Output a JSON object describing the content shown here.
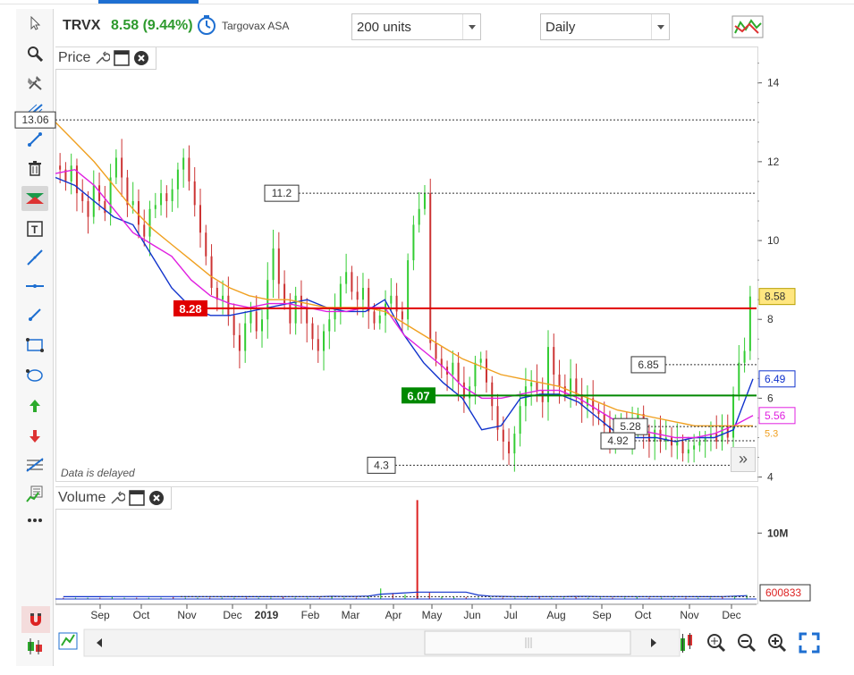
{
  "header": {
    "symbol": "TRVX",
    "change": "8.58 (9.44%)",
    "company": "Targovax ASA",
    "units_select": "200 units",
    "period_select": "Daily"
  },
  "panels": {
    "price_label": "Price",
    "volume_label": "Volume",
    "delayed_note": "Data is delayed"
  },
  "colors": {
    "up_candle": "#33cc33",
    "down_candle": "#cc3333",
    "ma_blue": "#1133cc",
    "ma_magenta": "#e020e0",
    "ma_orange": "#f0a020",
    "support_red": "#e00000",
    "support_green": "#008800"
  },
  "icons": {
    "left_toolbar": [
      "cursor-icon",
      "zoom-icon",
      "tools-icon",
      "crosshair-icon",
      "line-select-icon",
      "trash-icon",
      "rectangle-tool-icon",
      "text-tool-icon",
      "trendline-icon",
      "horizontal-line-icon",
      "ray-icon",
      "box-tool-icon",
      "ellipse-tool-icon",
      "arrow-up-icon",
      "arrow-down-icon",
      "fibonacci-icon",
      "indicator-icon",
      "more-icon"
    ],
    "bottom_toolbar": [
      "edit-chart-icon",
      "scroll-left-icon",
      "scroll-right-icon",
      "chart-type-icon",
      "zoom-auto-icon",
      "zoom-out-icon",
      "zoom-in-icon",
      "fullscreen-icon"
    ]
  },
  "chart_data": [
    {
      "type": "candlestick",
      "title": "Price",
      "y_ticks": [
        "14",
        "12",
        "10",
        "8",
        "6",
        "4"
      ],
      "ylim": [
        3.9,
        14.9
      ],
      "x_ticks": [
        "Sep",
        "Oct",
        "Nov",
        "Dec",
        "2019",
        "Feb",
        "Mar",
        "Apr",
        "May",
        "Jun",
        "Jul",
        "Aug",
        "Sep",
        "Oct",
        "Nov",
        "Dec"
      ],
      "last_price": "8.58",
      "ma_labels": [
        "6.49",
        "5.56",
        "5.3"
      ],
      "annotations": [
        {
          "label": "13.06",
          "value": 13.06
        },
        {
          "label": "11.2",
          "value": 11.2
        },
        {
          "label": "6.85",
          "value": 6.85
        },
        {
          "label": "5.28",
          "value": 5.28
        },
        {
          "label": "4.92",
          "value": 4.92
        },
        {
          "label": "4.3",
          "value": 4.3
        }
      ],
      "support_lines": [
        {
          "label": "8.28",
          "value": 8.28,
          "color": "#e00000"
        },
        {
          "label": "6.07",
          "value": 6.07,
          "color": "#008800"
        }
      ],
      "series": [
        {
          "name": "Close",
          "values": [
            11.8,
            11.5,
            11.9,
            11.2,
            11.0,
            10.6,
            11.4,
            11.0,
            10.7,
            11.6,
            12.1,
            11.6,
            10.9,
            11.0,
            10.4,
            10.1,
            10.8,
            10.9,
            11.2,
            11.0,
            11.3,
            11.8,
            12.1,
            11.5,
            10.9,
            10.2,
            9.6,
            8.8,
            8.5,
            8.6,
            8.1,
            7.6,
            7.2,
            7.9,
            8.2,
            7.7,
            8.0,
            9.0,
            9.8,
            8.9,
            8.4,
            7.9,
            8.6,
            8.3,
            7.9,
            7.5,
            7.2,
            7.7,
            8.0,
            8.3,
            8.9,
            9.2,
            8.7,
            8.5,
            8.8,
            8.2,
            7.9,
            8.1,
            8.4,
            8.6,
            8.2,
            8.0,
            9.5,
            10.4,
            10.8,
            11.2,
            7.4,
            7.0,
            6.8,
            6.6,
            6.9,
            6.4,
            6.0,
            6.3,
            6.9,
            7.0,
            6.4,
            5.8,
            5.2,
            4.9,
            4.6,
            5.1,
            5.8,
            6.3,
            6.4,
            6.2,
            5.9,
            7.3,
            6.6,
            6.3,
            6.1,
            6.5,
            6.1,
            5.8,
            6.0,
            5.7,
            5.6,
            5.3,
            4.8,
            5.2,
            5.4,
            4.9,
            5.3,
            5.6,
            5.1,
            4.9,
            5.2,
            4.9,
            5.0,
            4.8,
            4.9,
            4.6,
            4.7,
            4.8,
            4.9,
            5.0,
            5.1,
            4.9,
            5.3,
            5.0,
            6.1,
            6.9,
            7.2,
            8.58
          ]
        },
        {
          "name": "MA blue",
          "values": [
            11.6,
            11.4,
            11.0,
            10.6,
            10.4,
            9.6,
            8.8,
            8.3,
            8.1,
            8.1,
            8.2,
            8.3,
            8.4,
            8.5,
            8.3,
            8.2,
            8.2,
            8.5,
            7.6,
            6.9,
            6.4,
            6.0,
            5.2,
            5.3,
            6.0,
            6.1,
            6.1,
            5.9,
            5.5,
            5.1,
            5.0,
            5.0,
            4.9,
            5.0,
            5.0,
            5.2,
            6.49
          ]
        },
        {
          "name": "MA magenta",
          "values": [
            11.7,
            11.8,
            11.4,
            10.8,
            10.2,
            9.9,
            9.6,
            9.0,
            8.6,
            8.4,
            8.3,
            8.4,
            8.4,
            8.3,
            8.2,
            8.2,
            8.3,
            8.3,
            7.6,
            7.2,
            6.8,
            6.3,
            6.0,
            6.0,
            6.1,
            6.2,
            6.2,
            6.0,
            5.7,
            5.4,
            5.2,
            5.1,
            5.0,
            5.0,
            5.1,
            5.3,
            5.56
          ]
        },
        {
          "name": "MA orange",
          "values": [
            13.0,
            12.5,
            12.0,
            11.4,
            10.8,
            10.3,
            9.9,
            9.5,
            9.1,
            8.8,
            8.6,
            8.5,
            8.5,
            8.4,
            8.3,
            8.3,
            8.3,
            8.2,
            7.9,
            7.6,
            7.3,
            7.0,
            6.8,
            6.6,
            6.5,
            6.4,
            6.3,
            6.1,
            5.9,
            5.7,
            5.6,
            5.5,
            5.4,
            5.3,
            5.3,
            5.3,
            5.3
          ]
        }
      ]
    },
    {
      "type": "bar",
      "title": "Volume",
      "y_ticks": [
        "10M"
      ],
      "last_volume": "600833",
      "spike_month": "Apr",
      "values": [
        0.2,
        0.2,
        0.2,
        0.2,
        0.3,
        0.2,
        0.2,
        0.2,
        0.2,
        0.3,
        0.2,
        0.2,
        0.2,
        0.2,
        0.2,
        0.2,
        0.2,
        0.2,
        0.3,
        0.2,
        0.2,
        0.2,
        0.4,
        0.2,
        0.2,
        0.5,
        1.6,
        0.9,
        0.7,
        15.0,
        1.0,
        0.4,
        0.3,
        0.3,
        0.2,
        0.2,
        0.2,
        0.2,
        0.2,
        0.3,
        0.2,
        0.2,
        0.3,
        0.2,
        0.2,
        0.2,
        0.2,
        0.3,
        0.2,
        0.2,
        0.2,
        0.2,
        0.2,
        0.2,
        0.3,
        0.5,
        0.6
      ]
    }
  ]
}
